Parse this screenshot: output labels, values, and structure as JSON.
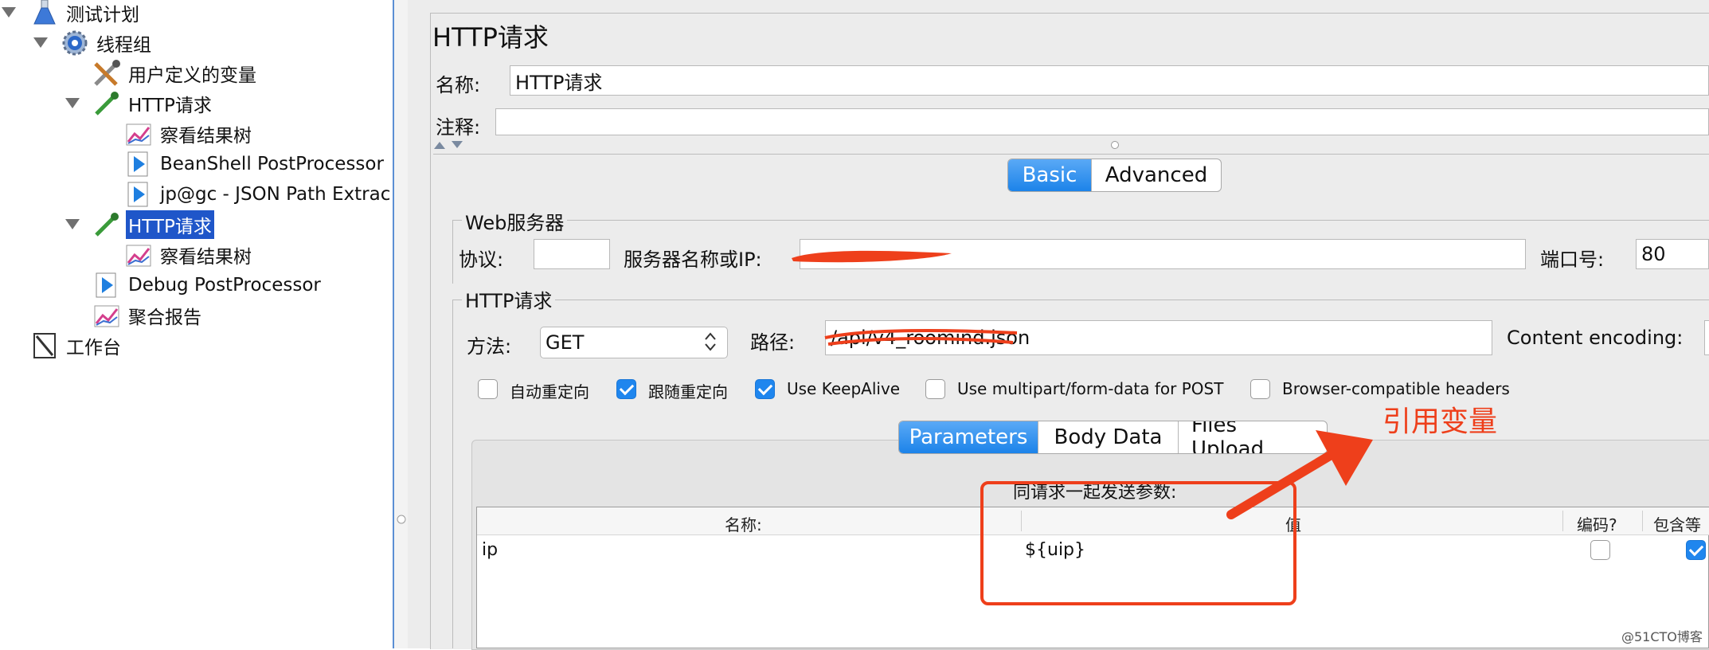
{
  "tree": {
    "items": [
      {
        "label": "测试计划",
        "icon": "flask-icon"
      },
      {
        "label": "线程组",
        "icon": "gear-icon"
      },
      {
        "label": "用户定义的变量",
        "icon": "wrench-icon"
      },
      {
        "label": "HTTP请求",
        "icon": "pipette-icon"
      },
      {
        "label": "察看结果树",
        "icon": "graph-icon"
      },
      {
        "label": "BeanShell PostProcessor",
        "icon": "arrow-doc-icon"
      },
      {
        "label": "jp@gc - JSON Path Extrac",
        "icon": "arrow-doc-icon"
      },
      {
        "label": "HTTP请求",
        "icon": "pipette-icon"
      },
      {
        "label": "察看结果树",
        "icon": "graph-icon"
      },
      {
        "label": "Debug PostProcessor",
        "icon": "arrow-doc-icon"
      },
      {
        "label": "聚合报告",
        "icon": "graph-icon"
      },
      {
        "label": "工作台",
        "icon": "clipboard-icon"
      }
    ]
  },
  "form": {
    "title": "HTTP请求",
    "name_label": "名称:",
    "name_value": "HTTP请求",
    "comment_label": "注释:",
    "tabs": {
      "basic": "Basic",
      "advanced": "Advanced"
    },
    "web_server": {
      "legend": "Web服务器",
      "protocol_label": "协议:",
      "server_label": "服务器名称或IP:",
      "port_label": "端口号:",
      "port_value": "80"
    },
    "http_request": {
      "legend": "HTTP请求",
      "method_label": "方法:",
      "method_value": "GET",
      "path_label": "路径:",
      "path_value": "/api/v4_roomind.json",
      "encoding_label": "Content encoding:"
    },
    "options": [
      {
        "label": "自动重定向",
        "checked": false
      },
      {
        "label": "跟随重定向",
        "checked": true
      },
      {
        "label": "Use KeepAlive",
        "checked": true
      },
      {
        "label": "Use multipart/form-data for POST",
        "checked": false
      },
      {
        "label": "Browser-compatible headers",
        "checked": false
      }
    ],
    "param_tabs": {
      "parameters": "Parameters",
      "body": "Body Data",
      "files": "Files Upload"
    },
    "params_caption": "同请求一起发送参数:",
    "columns": {
      "name": "名称:",
      "value": "值",
      "encode": "编码?",
      "include": "包含等"
    },
    "rows": [
      {
        "name": "ip",
        "value": "${uip}",
        "encode": false,
        "include": true
      }
    ]
  },
  "annotation": {
    "text": "引用变量",
    "color": "#ee3f1b"
  },
  "watermark": "@51CTO博客"
}
